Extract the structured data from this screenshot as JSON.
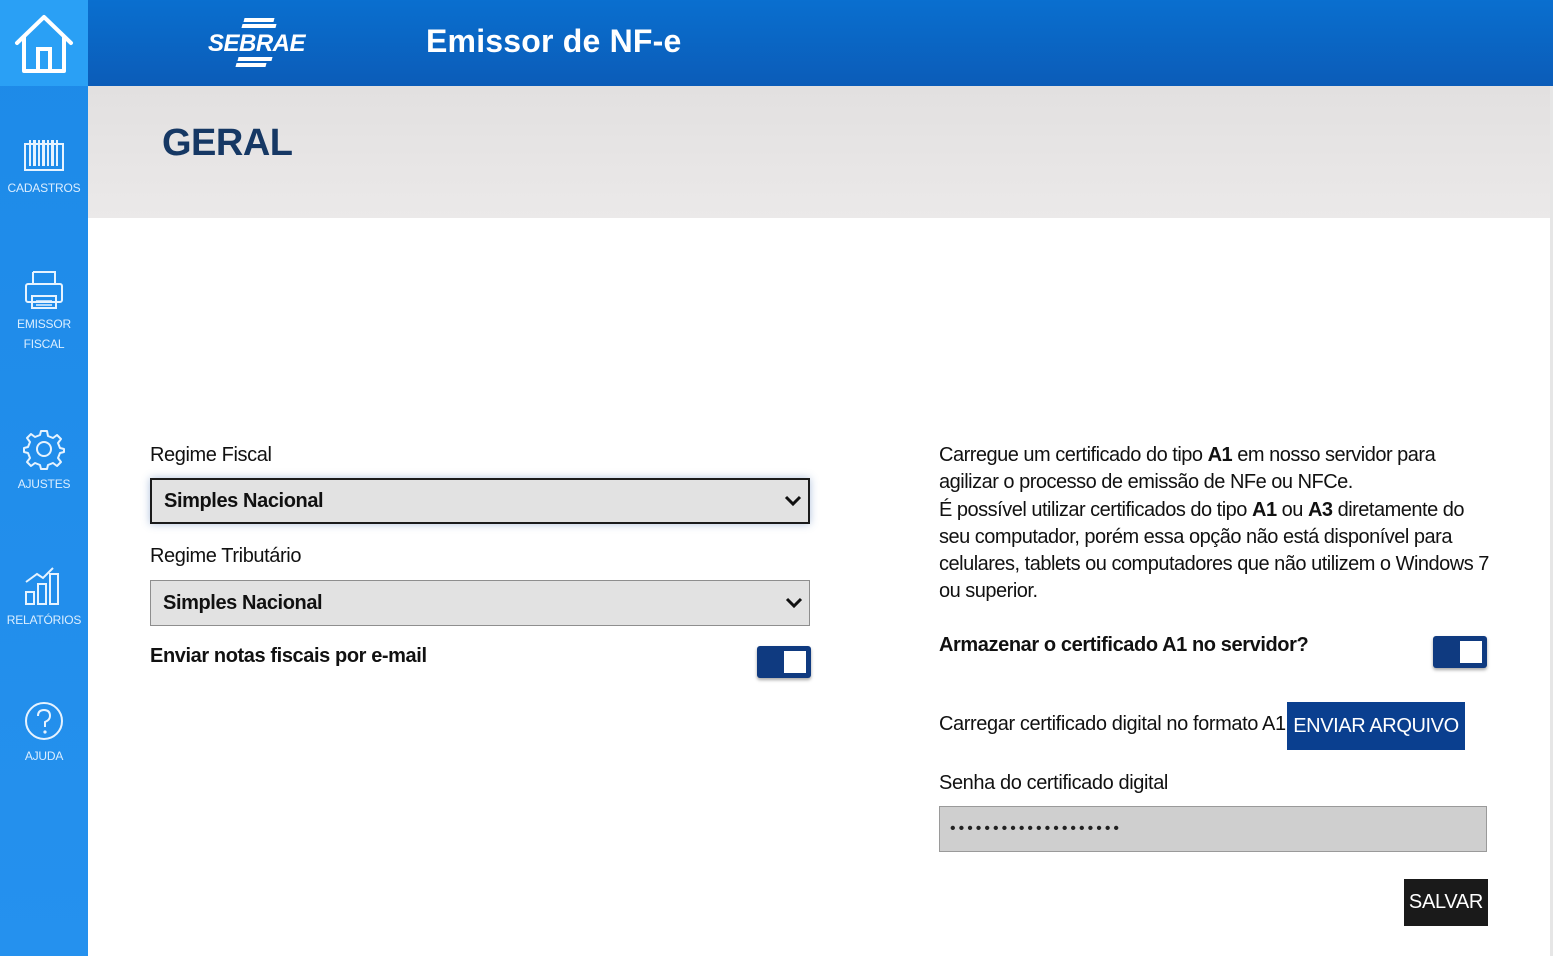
{
  "header": {
    "logo_text": "SEBRAE",
    "app_title": "Emissor de NF-e"
  },
  "sidebar": {
    "items": [
      {
        "label": "CADASTROS",
        "icon": "barcode-icon"
      },
      {
        "label": "EMISSOR",
        "label2": "FISCAL",
        "icon": "printer-icon"
      },
      {
        "label": "AJUSTES",
        "icon": "gear-icon"
      },
      {
        "label": "RELATÓRIOS",
        "icon": "bar-chart-icon"
      },
      {
        "label": "AJUDA",
        "icon": "help-icon"
      }
    ]
  },
  "page": {
    "title": "GERAL"
  },
  "form": {
    "regime_fiscal_label": "Regime Fiscal",
    "regime_fiscal_value": "Simples Nacional",
    "regime_tributario_label": "Regime Tributário",
    "regime_tributario_value": "Simples Nacional",
    "email_toggle_label": "Enviar notas fiscais por e-mail",
    "email_toggle_on": true
  },
  "certificate": {
    "info_1a": "Carregue um certificado do tipo ",
    "info_1b": "A1",
    "info_1c": " em nosso servidor para agilizar o processo de emissão de NFe ou NFCe.",
    "info_2a": "É possível utilizar certificados do tipo ",
    "info_2b": "A1",
    "info_2c": " ou ",
    "info_2d": "A3",
    "info_2e": " diretamente do seu computador, porém essa opção não está disponível para celulares, tablets ou computadores que não utilizem o Windows 7 ou superior.",
    "store_label": "Armazenar o certificado A1 no servidor?",
    "store_on": true,
    "upload_label": "Carregar certificado digital no formato A1",
    "upload_button": "ENVIAR ARQUIVO",
    "password_label": "Senha do certificado digital",
    "password_value": "••••••••••••••••••••",
    "save_button": "SALVAR"
  },
  "colors": {
    "header_blue": "#0b5cb8",
    "sidebar_blue": "#2591ee",
    "title_color": "#163864",
    "toggle_on": "#0f3a80",
    "primary_button": "#0a3f8f",
    "save_button": "#1a1a1a"
  }
}
